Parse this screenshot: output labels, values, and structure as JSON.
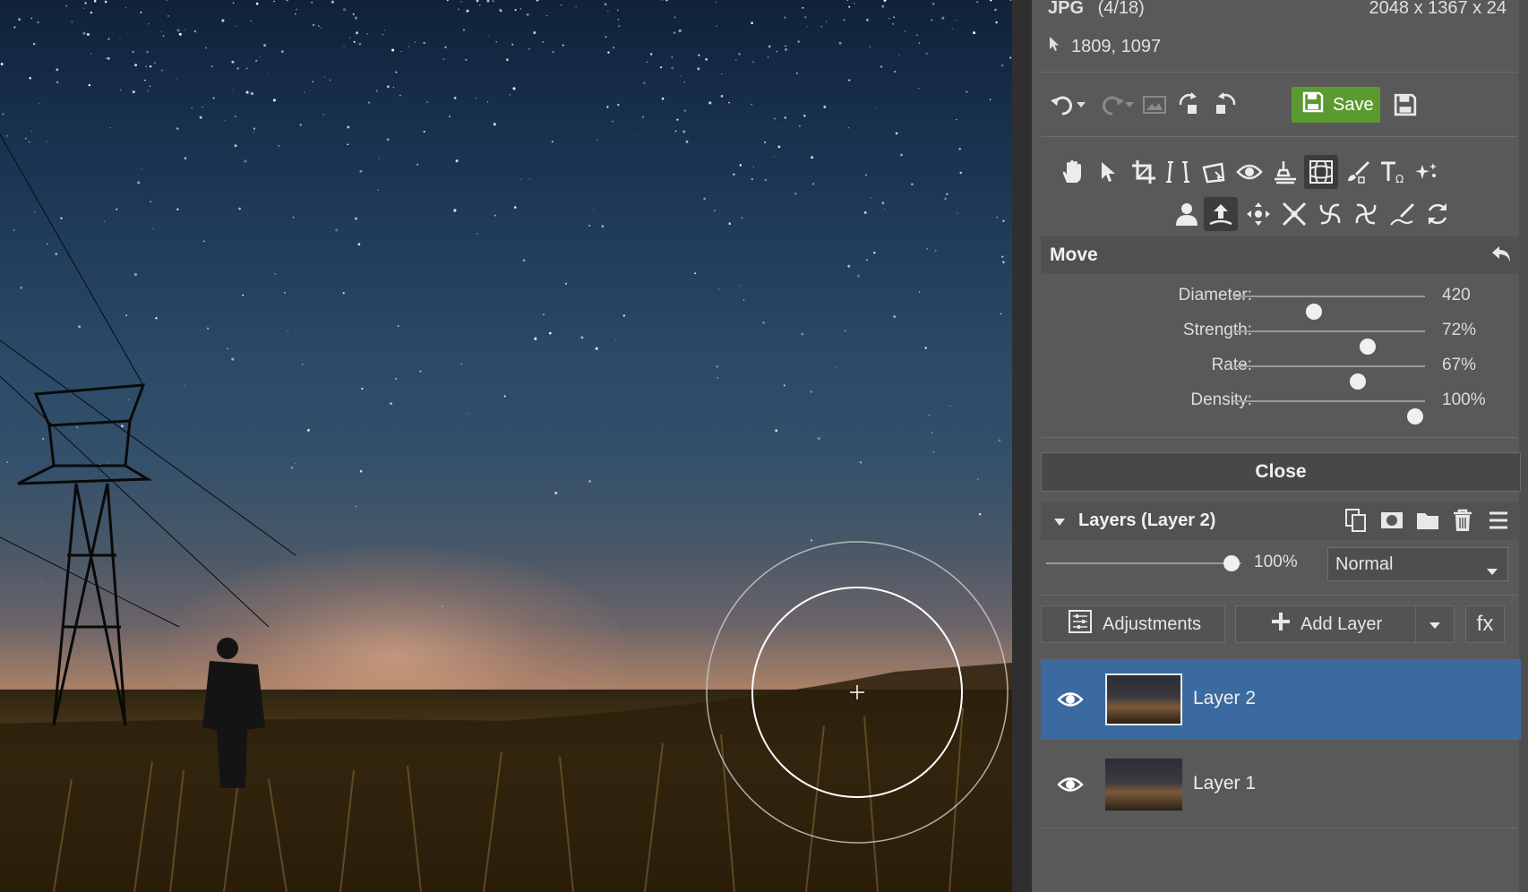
{
  "file_info": {
    "format": "JPG",
    "index": "(4/18)",
    "dimensions": "2048 x 1367 x 24",
    "cursor_pos": "1809, 1097"
  },
  "toolbar": {
    "save_label": "Save"
  },
  "move_panel": {
    "title": "Move",
    "sliders": [
      {
        "label": "Diameter:",
        "value": "420",
        "level": 0.42
      },
      {
        "label": "Strength:",
        "value": "72%",
        "level": 0.7
      },
      {
        "label": "Rate:",
        "value": "67%",
        "level": 0.65
      },
      {
        "label": "Density:",
        "value": "100%",
        "level": 0.95
      }
    ]
  },
  "close_label": "Close",
  "layers": {
    "title": "Layers (Layer 2)",
    "opacity": "100%",
    "opacity_level": 0.95,
    "blend_mode": "Normal",
    "adjustments_label": "Adjustments",
    "add_layer_label": "Add Layer",
    "fx_label": "fx",
    "items": [
      {
        "name": "Layer 2",
        "selected": true
      },
      {
        "name": "Layer 1",
        "selected": false
      }
    ]
  },
  "colors": {
    "accent_selected": "#3b6aa0",
    "save_green": "#5b9a2e",
    "panel_bg": "#595959"
  }
}
